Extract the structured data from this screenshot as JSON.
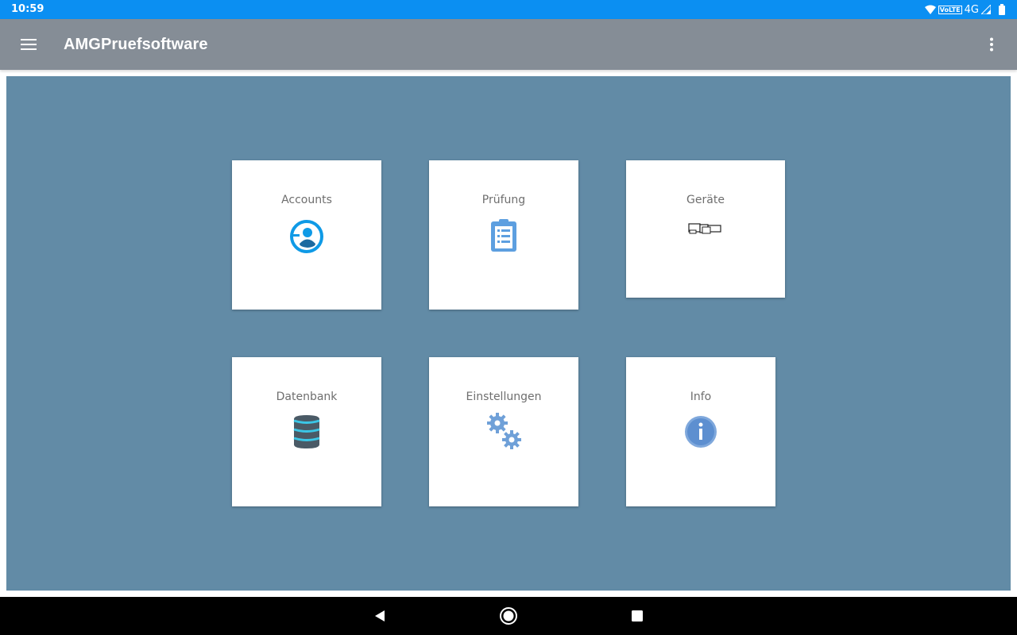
{
  "status_bar": {
    "time": "10:59",
    "volte": "VoLTE",
    "network": "4G",
    "icons": [
      "wifi-icon",
      "signal-icon",
      "battery-icon"
    ]
  },
  "app_bar": {
    "title": "AMGPruefsoftware",
    "menu_icon": "hamburger-menu-icon",
    "overflow_icon": "more-vertical-icon",
    "color": "#858d96"
  },
  "main": {
    "background": "#628ba6",
    "tiles": [
      {
        "label": "Accounts",
        "icon": "account-circle-icon"
      },
      {
        "label": "Prüfung",
        "icon": "clipboard-list-icon"
      },
      {
        "label": "Geräte",
        "icon": "devices-icon"
      },
      {
        "label": "Datenbank",
        "icon": "database-icon"
      },
      {
        "label": "Einstellungen",
        "icon": "gears-icon"
      },
      {
        "label": "Info",
        "icon": "info-icon"
      }
    ]
  },
  "nav_bar": {
    "buttons": [
      "back-icon",
      "home-icon",
      "recents-icon"
    ]
  }
}
